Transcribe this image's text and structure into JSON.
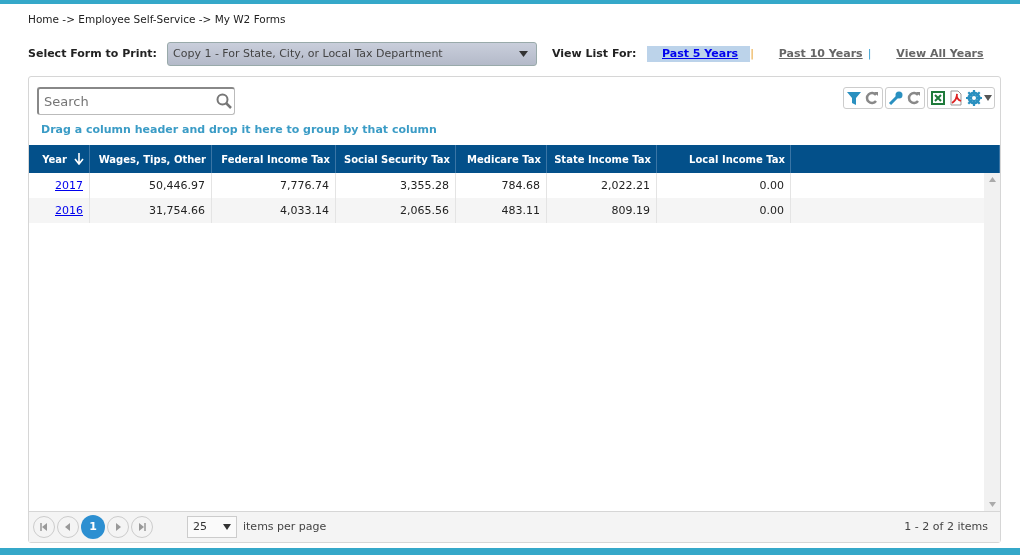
{
  "breadcrumb": "Home -> Employee Self-Service -> My W2 Forms",
  "form_select": {
    "label": "Select Form to Print:",
    "value": "Copy 1 - For State, City, or Local Tax Department"
  },
  "view_list": {
    "label": "View List For:",
    "options": [
      {
        "label": "Past 5 Years",
        "selected": true
      },
      {
        "label": "Past 10 Years",
        "selected": false
      },
      {
        "label": "View All Years",
        "selected": false
      }
    ],
    "separators": [
      "|",
      "|"
    ]
  },
  "search": {
    "placeholder": "Search"
  },
  "group_hint": "Drag a column header and drop it here to group by that column",
  "table": {
    "columns": [
      {
        "label": "Year",
        "sorted": true
      },
      {
        "label": "Wages, Tips, Other",
        "sorted": false
      },
      {
        "label": "Federal Income Tax",
        "sorted": false
      },
      {
        "label": "Social Security Tax",
        "sorted": false
      },
      {
        "label": "Medicare Tax",
        "sorted": false
      },
      {
        "label": "State Income Tax",
        "sorted": false
      },
      {
        "label": "Local Income Tax",
        "sorted": false
      }
    ],
    "rows": [
      [
        "2017",
        "50,446.97",
        "7,776.74",
        "3,355.28",
        "784.68",
        "2,022.21",
        "0.00"
      ],
      [
        "2016",
        "31,754.66",
        "4,033.14",
        "2,065.56",
        "483.11",
        "809.19",
        "0.00"
      ]
    ]
  },
  "pager": {
    "pages": [
      {
        "label": "1",
        "selected": true
      }
    ],
    "page_size": "25",
    "page_size_label": "items per page",
    "summary": "1 - 2 of 2 items"
  }
}
